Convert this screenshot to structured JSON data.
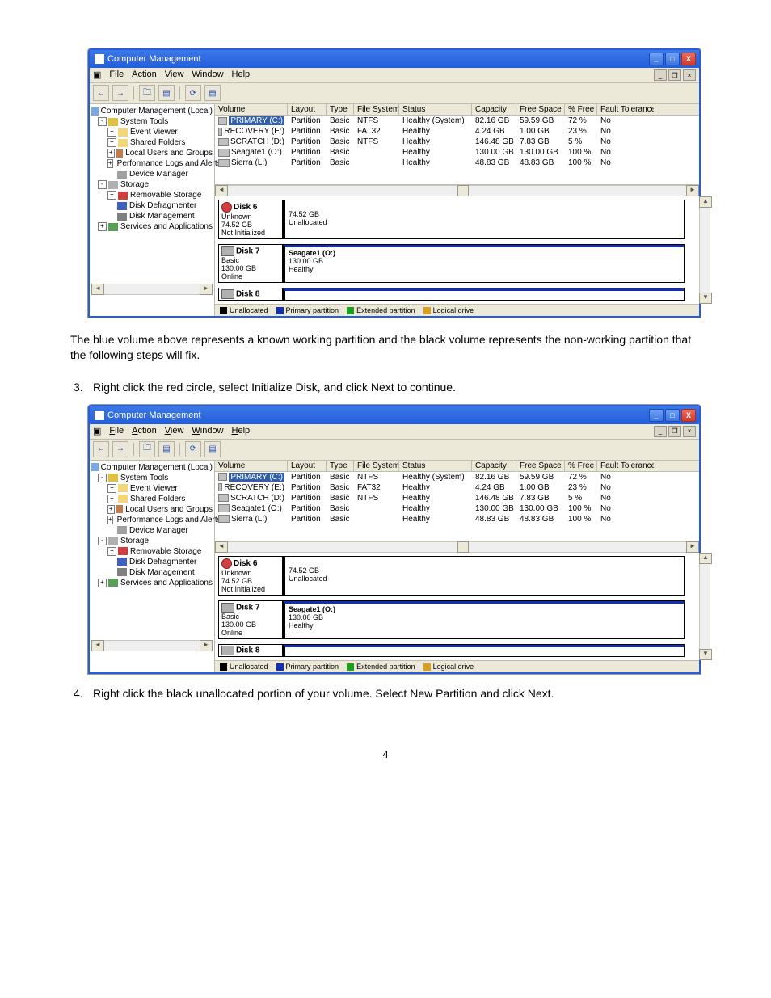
{
  "page_number": "4",
  "p1": "The blue volume above represents a known working partition and the black volume represents the non-working partition that the following steps will fix.",
  "step3_num": "3.",
  "step3": "Right click the red circle, select Initialize Disk, and click Next to continue.",
  "step4_num": "4.",
  "step4": "Right click the black unallocated portion of your volume. Select New Partition and click Next.",
  "win": {
    "title": "Computer Management",
    "min": "_",
    "max": "□",
    "close": "X",
    "mdi_restore": "❐",
    "mdi_close": "×",
    "mdi_min": "_",
    "menu": {
      "file": "File",
      "action": "Action",
      "view": "View",
      "window": "Window",
      "help": "Help"
    },
    "toolbar": {
      "back": "←",
      "fwd": "→",
      "up": "🗀",
      "props": "▤",
      "refresh": "⟳",
      "help": "?"
    }
  },
  "tree": {
    "root": "Computer Management (Local)",
    "system_tools": "System Tools",
    "event_viewer": "Event Viewer",
    "shared_folders": "Shared Folders",
    "local_users": "Local Users and Groups",
    "perf_logs": "Performance Logs and Alerts",
    "device_manager": "Device Manager",
    "storage": "Storage",
    "removable": "Removable Storage",
    "defrag": "Disk Defragmenter",
    "disk_mgmt": "Disk Management",
    "services": "Services and Applications"
  },
  "cols": {
    "volume": "Volume",
    "layout": "Layout",
    "type": "Type",
    "fs": "File System",
    "status": "Status",
    "cap": "Capacity",
    "free": "Free Space",
    "pct": "% Free",
    "fault": "Fault Tolerance"
  },
  "vols": [
    {
      "name": "PRIMARY (C:)",
      "layout": "Partition",
      "type": "Basic",
      "fs": "NTFS",
      "status": "Healthy (System)",
      "cap": "82.16 GB",
      "free": "59.59 GB",
      "pct": "72 %",
      "fault": "No",
      "sel": true
    },
    {
      "name": "RECOVERY (E:)",
      "layout": "Partition",
      "type": "Basic",
      "fs": "FAT32",
      "status": "Healthy",
      "cap": "4.24 GB",
      "free": "1.00 GB",
      "pct": "23 %",
      "fault": "No"
    },
    {
      "name": "SCRATCH (D:)",
      "layout": "Partition",
      "type": "Basic",
      "fs": "NTFS",
      "status": "Healthy",
      "cap": "146.48 GB",
      "free": "7.83 GB",
      "pct": "5 %",
      "fault": "No"
    },
    {
      "name": "Seagate1 (O:)",
      "layout": "Partition",
      "type": "Basic",
      "fs": "",
      "status": "Healthy",
      "cap": "130.00 GB",
      "free": "130.00 GB",
      "pct": "100 %",
      "fault": "No"
    },
    {
      "name": "Sierra (L:)",
      "layout": "Partition",
      "type": "Basic",
      "fs": "",
      "status": "Healthy",
      "cap": "48.83 GB",
      "free": "48.83 GB",
      "pct": "100 %",
      "fault": "No"
    }
  ],
  "disk6": {
    "title": "Disk 6",
    "l1": "Unknown",
    "l2": "74.52 GB",
    "l3": "Not Initialized",
    "part_l1": "74.52 GB",
    "part_l2": "Unallocated"
  },
  "disk7": {
    "title": "Disk 7",
    "l1": "Basic",
    "l2": "130.00 GB",
    "l3": "Online",
    "part_t": "Seagate1 (O:)",
    "part_l1": "130.00 GB",
    "part_l2": "Healthy"
  },
  "disk8": {
    "title": "Disk 8"
  },
  "legend": {
    "unalloc": "Unallocated",
    "primary": "Primary partition",
    "ext": "Extended partition",
    "logical": "Logical drive"
  }
}
